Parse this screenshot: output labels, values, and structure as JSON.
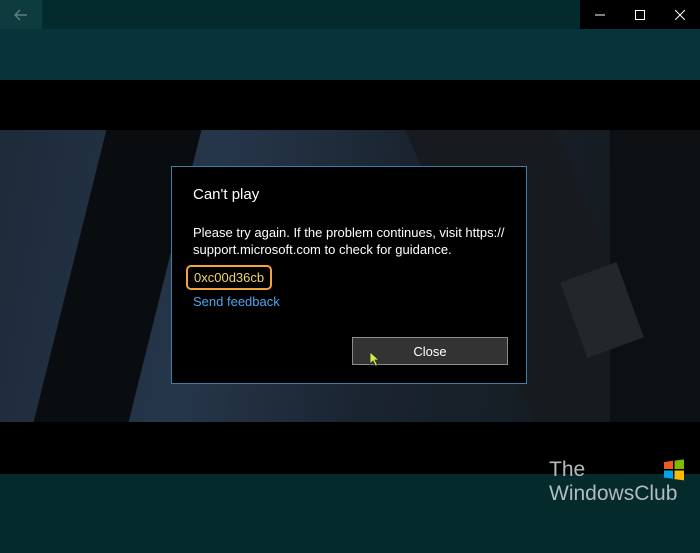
{
  "window": {
    "back_icon": "back-arrow-icon",
    "controls": [
      {
        "name": "minimize",
        "icon": "minimize-icon"
      },
      {
        "name": "maximize",
        "icon": "maximize-icon"
      },
      {
        "name": "close",
        "icon": "close-icon"
      }
    ]
  },
  "dialog": {
    "title": "Can't play",
    "message": "Please try again. If the problem continues, visit https:// support.microsoft.com to check for guidance.",
    "error_code": "0xc00d36cb",
    "feedback_link": "Send feedback",
    "close_label": "Close"
  },
  "watermark": {
    "line1": "The",
    "line2": "WindowsClub"
  },
  "colors": {
    "dialog_border": "#3e7fa8",
    "error_highlight": "#f0a43a",
    "link": "#4aa3f0",
    "button_bg": "#333333"
  }
}
